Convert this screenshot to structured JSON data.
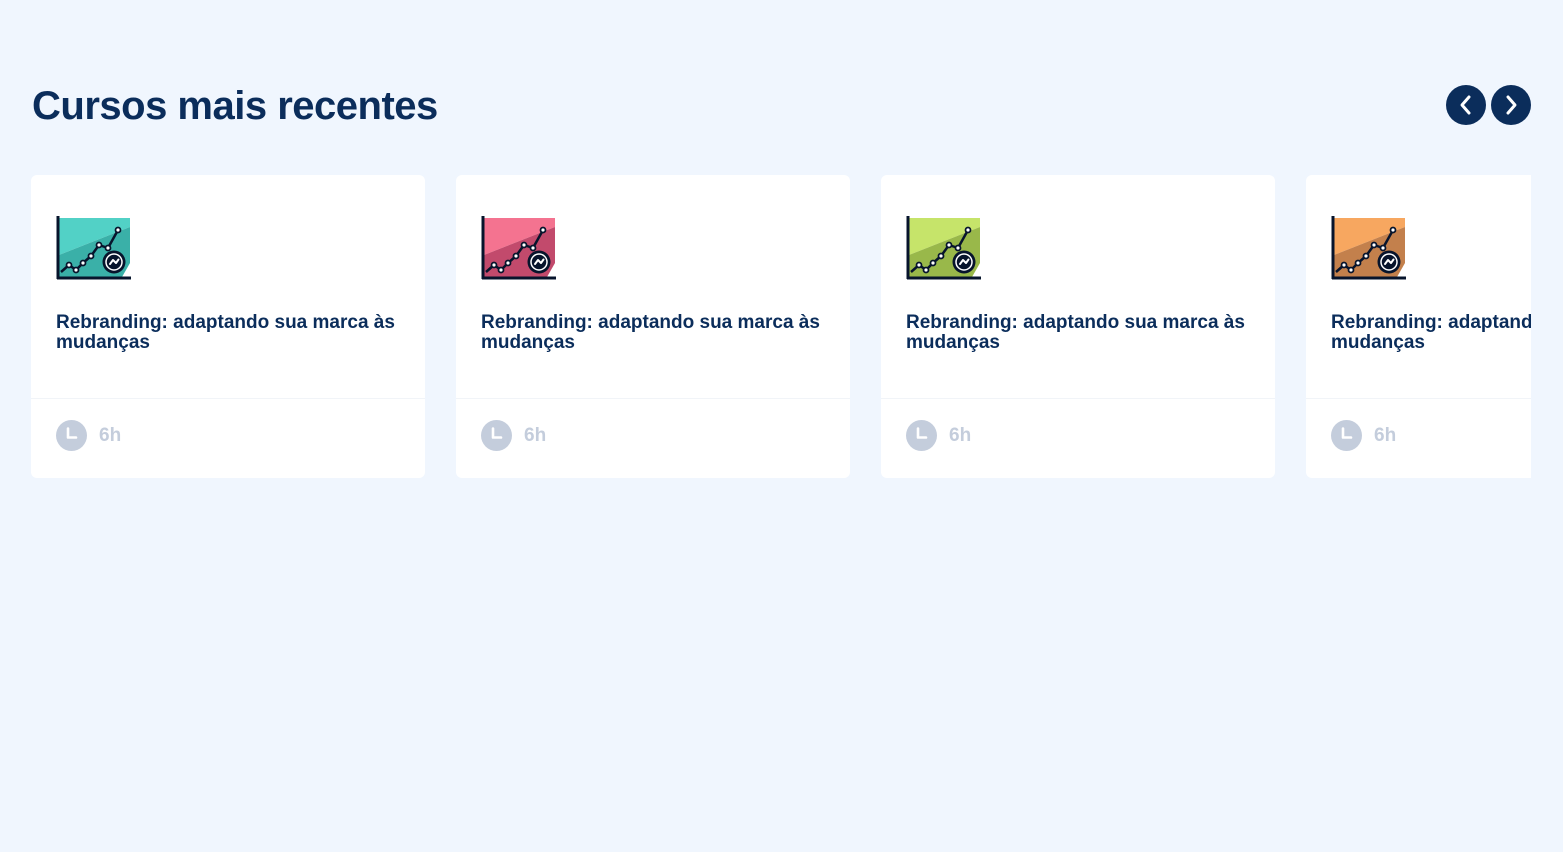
{
  "section": {
    "title": "Cursos mais recentes"
  },
  "navigation": {
    "prev_icon": "chevron-left-icon",
    "next_icon": "chevron-right-icon",
    "button_color": "#0b2d5b"
  },
  "courses": [
    {
      "title": "Rebranding: adaptando sua marca às mudanças",
      "duration": "6h",
      "icon": "growth-chart-icon",
      "colors": {
        "light": "#52d1c6",
        "dark": "#3ab0a8"
      }
    },
    {
      "title": "Rebranding: adaptando sua marca às mudanças",
      "duration": "6h",
      "icon": "growth-chart-icon",
      "colors": {
        "light": "#f47390",
        "dark": "#c24a6c"
      }
    },
    {
      "title": "Rebranding: adaptando sua marca às mudanças",
      "duration": "6h",
      "icon": "growth-chart-icon",
      "colors": {
        "light": "#c6e46a",
        "dark": "#99b84a"
      }
    },
    {
      "title": "Rebranding: adaptando sua marca às mudanças",
      "duration": "6h",
      "icon": "growth-chart-icon",
      "colors": {
        "light": "#f7a760",
        "dark": "#c3804c"
      }
    }
  ],
  "theme": {
    "background": "#f0f6fe",
    "text": "#0b2d5b",
    "muted": "#c4cddc"
  }
}
